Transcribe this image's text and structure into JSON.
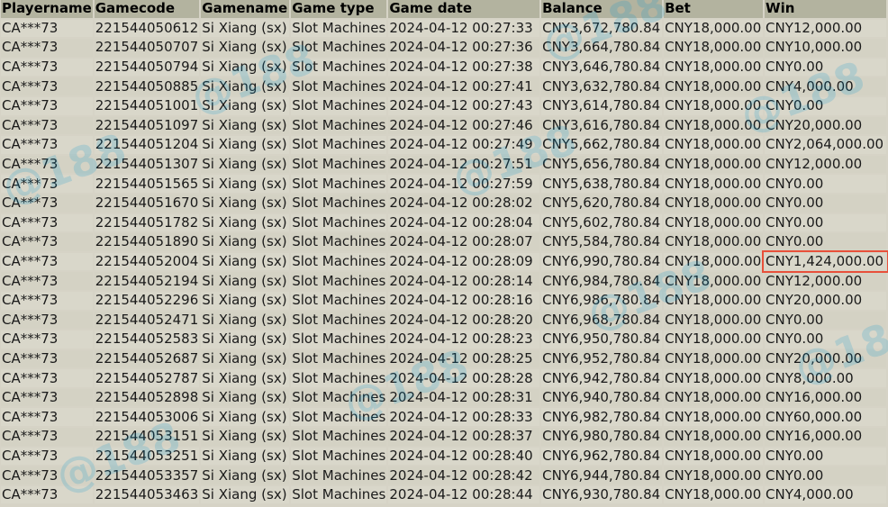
{
  "table": {
    "columns": [
      "Playername",
      "Gamecode",
      "Gamename",
      "Game type",
      "Game date",
      "Balance",
      "Bet",
      "Win"
    ],
    "highlighted_row_index": 13,
    "highlight_color": "#e8503a",
    "rows": [
      [
        "CA***73",
        "221544050612",
        "Si Xiang (sx)",
        "Slot Machines",
        "2024-04-12 00:27:33",
        "CNY3,672,780.84",
        "CNY18,000.00",
        "CNY12,000.00"
      ],
      [
        "CA***73",
        "221544050707",
        "Si Xiang (sx)",
        "Slot Machines",
        "2024-04-12 00:27:36",
        "CNY3,664,780.84",
        "CNY18,000.00",
        "CNY10,000.00"
      ],
      [
        "CA***73",
        "221544050794",
        "Si Xiang (sx)",
        "Slot Machines",
        "2024-04-12 00:27:38",
        "CNY3,646,780.84",
        "CNY18,000.00",
        "CNY0.00"
      ],
      [
        "CA***73",
        "221544050885",
        "Si Xiang (sx)",
        "Slot Machines",
        "2024-04-12 00:27:41",
        "CNY3,632,780.84",
        "CNY18,000.00",
        "CNY4,000.00"
      ],
      [
        "CA***73",
        "221544051001",
        "Si Xiang (sx)",
        "Slot Machines",
        "2024-04-12 00:27:43",
        "CNY3,614,780.84",
        "CNY18,000.00",
        "CNY0.00"
      ],
      [
        "CA***73",
        "221544051097",
        "Si Xiang (sx)",
        "Slot Machines",
        "2024-04-12 00:27:46",
        "CNY3,616,780.84",
        "CNY18,000.00",
        "CNY20,000.00"
      ],
      [
        "CA***73",
        "221544051204",
        "Si Xiang (sx)",
        "Slot Machines",
        "2024-04-12 00:27:49",
        "CNY5,662,780.84",
        "CNY18,000.00",
        "CNY2,064,000.00"
      ],
      [
        "CA***73",
        "221544051307",
        "Si Xiang (sx)",
        "Slot Machines",
        "2024-04-12 00:27:51",
        "CNY5,656,780.84",
        "CNY18,000.00",
        "CNY12,000.00"
      ],
      [
        "CA***73",
        "221544051565",
        "Si Xiang (sx)",
        "Slot Machines",
        "2024-04-12 00:27:59",
        "CNY5,638,780.84",
        "CNY18,000.00",
        "CNY0.00"
      ],
      [
        "CA***73",
        "221544051670",
        "Si Xiang (sx)",
        "Slot Machines",
        "2024-04-12 00:28:02",
        "CNY5,620,780.84",
        "CNY18,000.00",
        "CNY0.00"
      ],
      [
        "CA***73",
        "221544051782",
        "Si Xiang (sx)",
        "Slot Machines",
        "2024-04-12 00:28:04",
        "CNY5,602,780.84",
        "CNY18,000.00",
        "CNY0.00"
      ],
      [
        "CA***73",
        "221544051890",
        "Si Xiang (sx)",
        "Slot Machines",
        "2024-04-12 00:28:07",
        "CNY5,584,780.84",
        "CNY18,000.00",
        "CNY0.00"
      ],
      [
        "CA***73",
        "221544052004",
        "Si Xiang (sx)",
        "Slot Machines",
        "2024-04-12 00:28:09",
        "CNY6,990,780.84",
        "CNY18,000.00",
        "CNY1,424,000.00"
      ],
      [
        "CA***73",
        "221544052194",
        "Si Xiang (sx)",
        "Slot Machines",
        "2024-04-12 00:28:14",
        "CNY6,984,780.84",
        "CNY18,000.00",
        "CNY12,000.00"
      ],
      [
        "CA***73",
        "221544052296",
        "Si Xiang (sx)",
        "Slot Machines",
        "2024-04-12 00:28:16",
        "CNY6,986,780.84",
        "CNY18,000.00",
        "CNY20,000.00"
      ],
      [
        "CA***73",
        "221544052471",
        "Si Xiang (sx)",
        "Slot Machines",
        "2024-04-12 00:28:20",
        "CNY6,968,780.84",
        "CNY18,000.00",
        "CNY0.00"
      ],
      [
        "CA***73",
        "221544052583",
        "Si Xiang (sx)",
        "Slot Machines",
        "2024-04-12 00:28:23",
        "CNY6,950,780.84",
        "CNY18,000.00",
        "CNY0.00"
      ],
      [
        "CA***73",
        "221544052687",
        "Si Xiang (sx)",
        "Slot Machines",
        "2024-04-12 00:28:25",
        "CNY6,952,780.84",
        "CNY18,000.00",
        "CNY20,000.00"
      ],
      [
        "CA***73",
        "221544052787",
        "Si Xiang (sx)",
        "Slot Machines",
        "2024-04-12 00:28:28",
        "CNY6,942,780.84",
        "CNY18,000.00",
        "CNY8,000.00"
      ],
      [
        "CA***73",
        "221544052898",
        "Si Xiang (sx)",
        "Slot Machines",
        "2024-04-12 00:28:31",
        "CNY6,940,780.84",
        "CNY18,000.00",
        "CNY16,000.00"
      ],
      [
        "CA***73",
        "221544053006",
        "Si Xiang (sx)",
        "Slot Machines",
        "2024-04-12 00:28:33",
        "CNY6,982,780.84",
        "CNY18,000.00",
        "CNY60,000.00"
      ],
      [
        "CA***73",
        "221544053151",
        "Si Xiang (sx)",
        "Slot Machines",
        "2024-04-12 00:28:37",
        "CNY6,980,780.84",
        "CNY18,000.00",
        "CNY16,000.00"
      ],
      [
        "CA***73",
        "221544053251",
        "Si Xiang (sx)",
        "Slot Machines",
        "2024-04-12 00:28:40",
        "CNY6,962,780.84",
        "CNY18,000.00",
        "CNY0.00"
      ],
      [
        "CA***73",
        "221544053357",
        "Si Xiang (sx)",
        "Slot Machines",
        "2024-04-12 00:28:42",
        "CNY6,944,780.84",
        "CNY18,000.00",
        "CNY0.00"
      ],
      [
        "CA***73",
        "221544053463",
        "Si Xiang (sx)",
        "Slot Machines",
        "2024-04-12 00:28:44",
        "CNY6,930,780.84",
        "CNY18,000.00",
        "CNY4,000.00"
      ]
    ]
  },
  "watermark": {
    "logo_text": "@188",
    "color": "#0096d2"
  }
}
